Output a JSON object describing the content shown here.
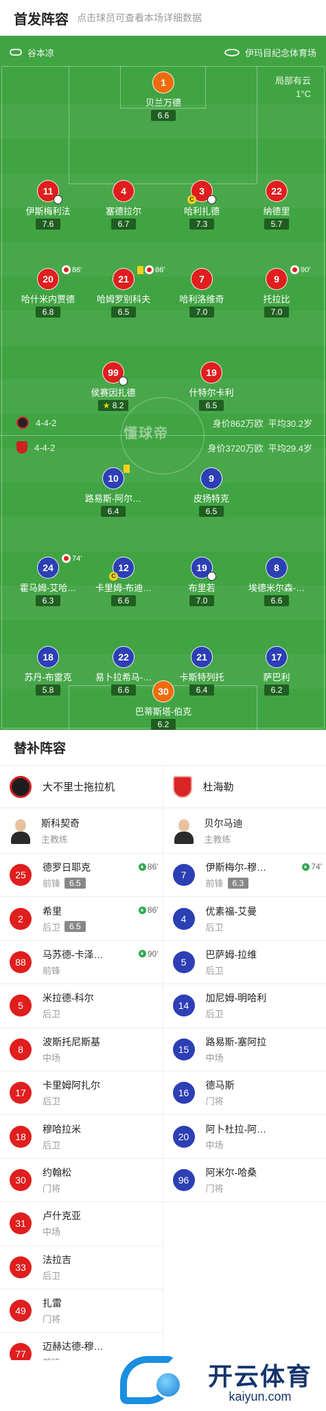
{
  "header": {
    "title": "首发阵容",
    "subtitle": "点击球员可查看本场详细数据"
  },
  "match": {
    "referee": "谷本凉",
    "stadium": "伊玛目纪念体育场",
    "weather": "局部有云",
    "temperature": "1°C"
  },
  "watermark": "懂球帝",
  "home_team": {
    "formation": "4-4-2",
    "value": "身价862万欧",
    "avg_age": "平均30.2岁"
  },
  "away_team": {
    "formation": "4-4-2",
    "value": "身价3720万欧",
    "avg_age": "平均29.4岁"
  },
  "home_players": [
    {
      "num": "1",
      "name": "贝兰万德",
      "rating": "6.6"
    },
    {
      "num": "11",
      "name": "伊斯梅利法",
      "rating": "7.6"
    },
    {
      "num": "4",
      "name": "塞德拉尔",
      "rating": "6.7"
    },
    {
      "num": "3",
      "name": "哈利扎德",
      "rating": "7.3"
    },
    {
      "num": "22",
      "name": "纳德里",
      "rating": "5.7"
    },
    {
      "num": "20",
      "name": "哈什米内贾德",
      "rating": "6.8",
      "sub": "86'"
    },
    {
      "num": "21",
      "name": "哈姆罗别科夫",
      "rating": "6.5",
      "sub": "86'"
    },
    {
      "num": "7",
      "name": "哈利洛维奇",
      "rating": "7.0"
    },
    {
      "num": "9",
      "name": "托拉比",
      "rating": "7.0",
      "sub": "90'"
    },
    {
      "num": "99",
      "name": "侯赛因扎德",
      "rating": "8.2"
    },
    {
      "num": "19",
      "name": "什特尔卡利",
      "rating": "6.5"
    }
  ],
  "away_players": [
    {
      "num": "10",
      "name": "路易斯-阿尔…",
      "rating": "6.4"
    },
    {
      "num": "9",
      "name": "皮扬特克",
      "rating": "6.5"
    },
    {
      "num": "24",
      "name": "霍马姆-艾哈…",
      "rating": "6.3",
      "sub": "74'"
    },
    {
      "num": "12",
      "name": "卡里姆-布迪…",
      "rating": "6.6"
    },
    {
      "num": "19",
      "name": "布里若",
      "rating": "7.0"
    },
    {
      "num": "8",
      "name": "埃德米尔森-…",
      "rating": "6.6"
    },
    {
      "num": "18",
      "name": "苏丹-布雷克",
      "rating": "5.8"
    },
    {
      "num": "22",
      "name": "易卜拉希马-…",
      "rating": "6.6"
    },
    {
      "num": "21",
      "name": "卡斯特列托",
      "rating": "6.4"
    },
    {
      "num": "17",
      "name": "萨巴利",
      "rating": "6.2"
    },
    {
      "num": "30",
      "name": "巴蒂斯塔-伯克",
      "rating": "6.2"
    }
  ],
  "subs": {
    "title": "替补阵容",
    "home": {
      "team": "大不里士拖拉机",
      "coach": {
        "name": "斯科契奇",
        "role": "主教练"
      },
      "players": [
        {
          "num": "25",
          "name": "德罗日耶克",
          "pos": "前锋",
          "rating": "6.5",
          "on": "86'"
        },
        {
          "num": "2",
          "name": "希里",
          "pos": "后卫",
          "rating": "6.5",
          "on": "86'"
        },
        {
          "num": "88",
          "name": "马苏德-卡泽…",
          "pos": "前锋",
          "on": "90'"
        },
        {
          "num": "5",
          "name": "米拉德-科尔",
          "pos": "后卫"
        },
        {
          "num": "8",
          "name": "波斯托尼斯基",
          "pos": "中场"
        },
        {
          "num": "17",
          "name": "卡里姆阿扎尔",
          "pos": "后卫"
        },
        {
          "num": "18",
          "name": "穆哈拉米",
          "pos": "后卫"
        },
        {
          "num": "30",
          "name": "约翰松",
          "pos": "门将"
        },
        {
          "num": "31",
          "name": "卢什克亚",
          "pos": "中场"
        },
        {
          "num": "33",
          "name": "法拉吉",
          "pos": "后卫"
        },
        {
          "num": "49",
          "name": "扎雷",
          "pos": "门将"
        },
        {
          "num": "77",
          "name": "迈赫达德-穆…",
          "pos": "前锋"
        }
      ]
    },
    "away": {
      "team": "杜海勒",
      "coach": {
        "name": "贝尔马迪",
        "role": "主教练"
      },
      "players": [
        {
          "num": "7",
          "name": "伊斯梅尔-穆…",
          "pos": "前锋",
          "rating": "6.3",
          "on": "74'"
        },
        {
          "num": "4",
          "name": "优素福-艾曼",
          "pos": "后卫"
        },
        {
          "num": "5",
          "name": "巴萨姆-拉维",
          "pos": "后卫"
        },
        {
          "num": "14",
          "name": "加尼姆-明哈利",
          "pos": "后卫"
        },
        {
          "num": "15",
          "name": "路易斯-塞阿拉",
          "pos": "中场"
        },
        {
          "num": "16",
          "name": "德马斯",
          "pos": "门将"
        },
        {
          "num": "20",
          "name": "阿卜杜拉-阿…",
          "pos": "中场"
        },
        {
          "num": "96",
          "name": "阿米尔-哈桑",
          "pos": "门将"
        }
      ]
    }
  },
  "brand": {
    "cn": "开云体育",
    "en": "kaiyun.com"
  }
}
